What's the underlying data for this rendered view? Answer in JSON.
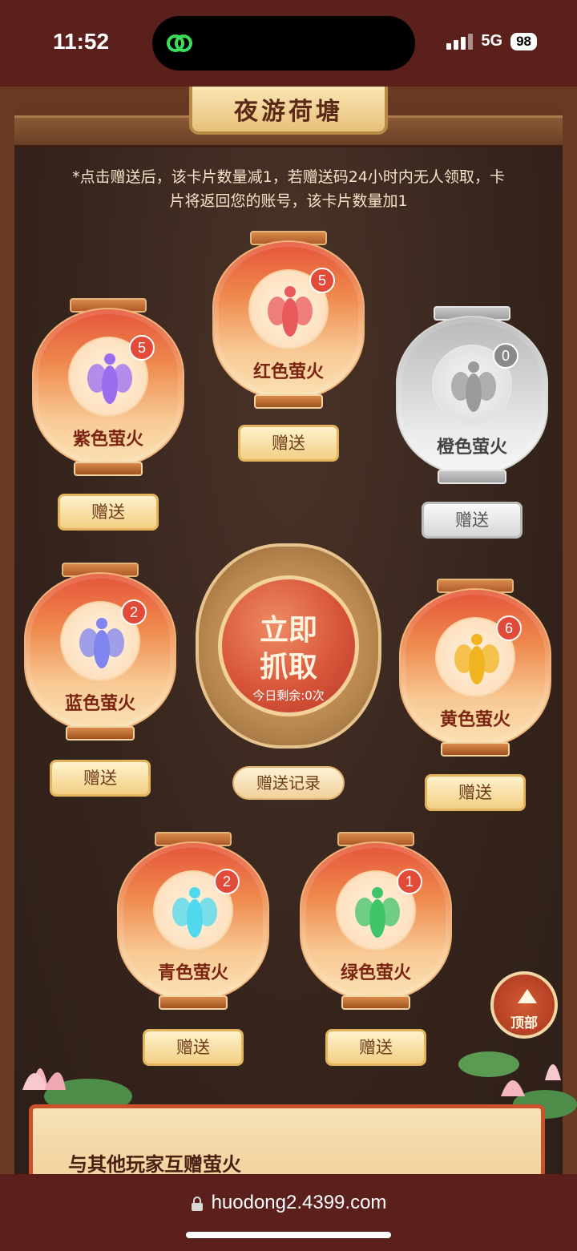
{
  "status": {
    "time": "11:52",
    "network": "5G",
    "battery": "98"
  },
  "page": {
    "title": "夜游荷塘",
    "notice": "*点击赠送后，该卡片数量减1，若赠送码24小时内无人领取，卡片将返回您的账号，该卡片数量加1"
  },
  "lanterns": [
    {
      "name": "紫色萤火",
      "count": "5",
      "color": "#9b6bf0"
    },
    {
      "name": "红色萤火",
      "count": "5",
      "color": "#e8595c"
    },
    {
      "name": "橙色萤火",
      "count": "0",
      "color": "#9a9a9a"
    },
    {
      "name": "蓝色萤火",
      "count": "2",
      "color": "#7f84ee"
    },
    {
      "name": "黄色萤火",
      "count": "6",
      "color": "#f2b320"
    },
    {
      "name": "青色萤火",
      "count": "2",
      "color": "#4fd8ee"
    },
    {
      "name": "绿色萤火",
      "count": "1",
      "color": "#3fc46a"
    }
  ],
  "buttons": {
    "gift": "赠送",
    "grab_line1": "立即",
    "grab_line2": "抓取",
    "remaining": "今日剩余:0次",
    "record": "赠送记录",
    "top": "顶部"
  },
  "bottom": {
    "title": "与其他玩家互赠萤火"
  },
  "browser": {
    "url": "huodong2.4399.com"
  }
}
